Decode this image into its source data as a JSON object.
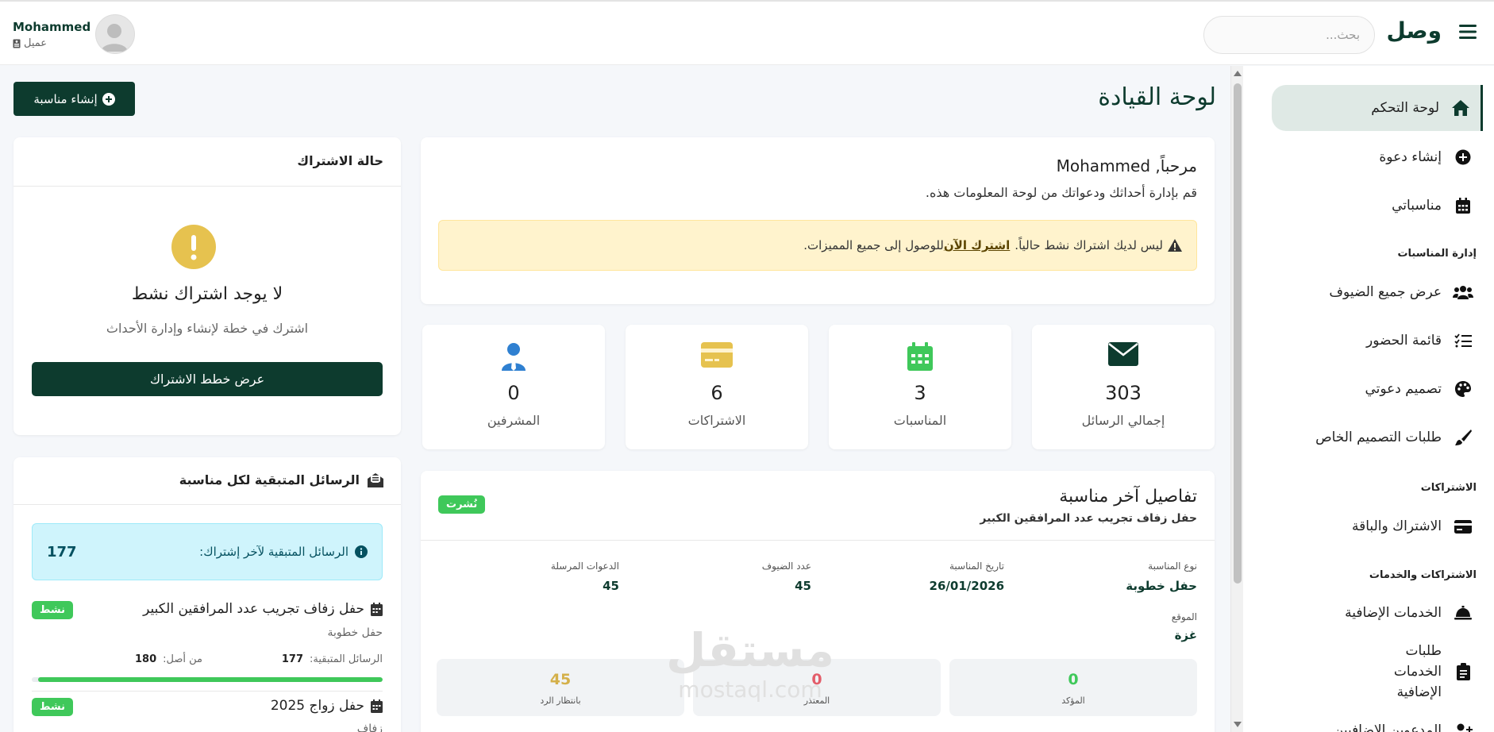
{
  "header": {
    "brand": "وصل",
    "search_placeholder": "بحث...",
    "user_name": "Mohammed",
    "user_role": "عميل"
  },
  "sidebar": {
    "items": [
      {
        "label": "لوحة التحكم",
        "icon": "home-icon"
      },
      {
        "label": "إنشاء دعوة",
        "icon": "plus-circle-icon"
      },
      {
        "label": "مناسباتي",
        "icon": "calendar-icon"
      },
      {
        "label": "عرض جميع الضيوف",
        "icon": "users-icon"
      },
      {
        "label": "قائمة الحضور",
        "icon": "checklist-icon"
      },
      {
        "label": "تصميم دعوتي",
        "icon": "palette-icon"
      },
      {
        "label": "طلبات التصميم الخاص",
        "icon": "brush-icon"
      },
      {
        "label": "الاشتراك والباقة",
        "icon": "credit-card-icon"
      },
      {
        "label": "الخدمات الإضافية",
        "icon": "bell-service-icon"
      },
      {
        "label": "طلبات الخدمات الإضافية",
        "icon": "clipboard-icon"
      },
      {
        "label": "المدعوين الإضافيين",
        "icon": "user-plus-icon"
      }
    ],
    "sections": [
      "إدارة المناسبات",
      "الاشتراكات",
      "الاشتراكات والخدمات"
    ]
  },
  "page": {
    "title": "لوحة القيادة",
    "create_button": "إنشاء مناسبة"
  },
  "welcome": {
    "title": "مرحباً, Mohammed",
    "subtitle": "قم بإدارة أحداثك ودعواتك من لوحة المعلومات هذه.",
    "alert_text": "ليس لديك اشتراك نشط حالياً.",
    "alert_link": "اشترك الآن",
    "alert_tail": "للوصول إلى جميع المميزات."
  },
  "stats": [
    {
      "value": "303",
      "label": "إجمالي الرسائل",
      "icon": "envelope-icon",
      "color": "#0d3b2e"
    },
    {
      "value": "3",
      "label": "المناسبات",
      "icon": "calendar-icon",
      "color": "#3fc85a"
    },
    {
      "value": "6",
      "label": "الاشتراكات",
      "icon": "credit-card-icon",
      "color": "#e6c24f"
    },
    {
      "value": "0",
      "label": "المشرفين",
      "icon": "user-tie-icon",
      "color": "#2f80d1"
    }
  ],
  "subscription": {
    "title": "حالة الاشتراك",
    "none_title": "لا يوجد اشتراك نشط",
    "none_desc": "اشترك في خطة لإنشاء وإدارة الأحداث",
    "plans_button": "عرض خطط الاشتراك"
  },
  "remaining": {
    "title": "الرسائل المتبقية لكل مناسبة",
    "info_label": "الرسائل المتبقية لآخر إشتراك:",
    "info_value": "177",
    "events": [
      {
        "name": "حفل زفاف تجريب عدد المرافقين الكبير",
        "type": "حفل خطوبة",
        "badge": "نشط",
        "remaining_label": "الرسائل المتبقية:",
        "remaining": "177",
        "of_label": "من أصل:",
        "total": "180",
        "progress": 0.983
      },
      {
        "name": "حفل زواج 2025",
        "type": "زفاف",
        "badge": "نشط"
      }
    ]
  },
  "latest": {
    "title": "تفاصيل آخر مناسبة",
    "subtitle": "حفل زفاف تجريب عدد المرافقين الكبير",
    "badge": "نُشرت",
    "fields": [
      {
        "label": "نوع المناسبة",
        "value": "حفل خطوبة"
      },
      {
        "label": "تاريخ المناسبة",
        "value": "26/01/2026"
      },
      {
        "label": "عدد الضيوف",
        "value": "45"
      },
      {
        "label": "الدعوات المرسلة",
        "value": "45"
      }
    ],
    "location_label": "الموقع",
    "location_value": "غزة",
    "rsvp": [
      {
        "value": "0",
        "label": "المؤكد",
        "color": "#3fc85a"
      },
      {
        "value": "0",
        "label": "المعتذر",
        "color": "#e35d6a"
      },
      {
        "value": "45",
        "label": "بانتظار الرد",
        "color": "#d4b04a"
      }
    ]
  },
  "watermark": {
    "ar": "مستقل",
    "en": "mostaql.com"
  }
}
